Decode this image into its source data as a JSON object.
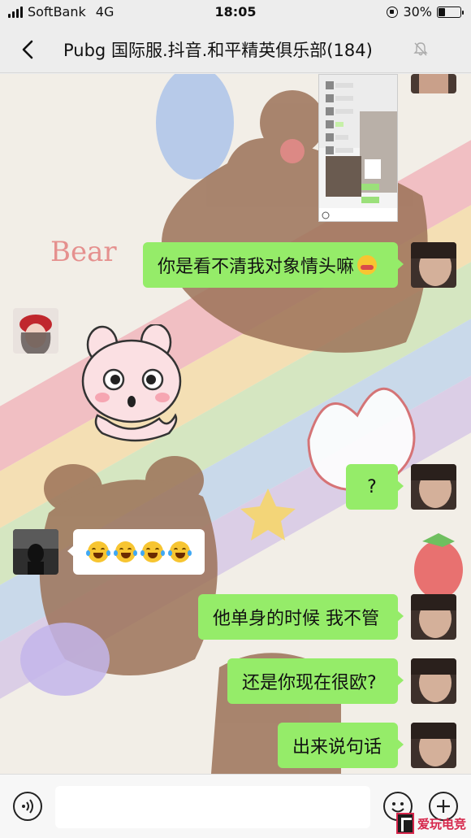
{
  "status_bar": {
    "carrier": "SoftBank",
    "network": "4G",
    "time": "18:05",
    "battery": "30%",
    "battery_level": 0.3
  },
  "header": {
    "title": "Pubg 国际服.抖音.和平精英俱乐部(184)"
  },
  "messages": [
    {
      "side": "sent",
      "kind": "image",
      "content": "screenshot"
    },
    {
      "side": "sent",
      "kind": "text",
      "text": "你是看不清我对象情头嘛",
      "emoji": "flushed-face"
    },
    {
      "side": "received",
      "kind": "sticker",
      "content": "bunny-sticker"
    },
    {
      "side": "sent",
      "kind": "text",
      "text": "?"
    },
    {
      "side": "received",
      "kind": "emoji",
      "emojis": [
        "tears-of-joy",
        "tears-of-joy",
        "tears-of-joy",
        "tears-of-joy"
      ]
    },
    {
      "side": "sent",
      "kind": "text",
      "text": "他单身的时候 我不管"
    },
    {
      "side": "sent",
      "kind": "text",
      "text": "还是你现在很欧?"
    },
    {
      "side": "sent",
      "kind": "text",
      "text": "出来说句话"
    }
  ],
  "input_bar": {
    "placeholder": "",
    "icons": [
      "voice-icon",
      "emoji-icon",
      "plus-icon"
    ]
  },
  "watermark": {
    "text": "爱玩电竞"
  },
  "colors": {
    "sent_bubble": "#95ec69",
    "received_bubble": "#ffffff",
    "header_bg": "#ededed",
    "watermark": "#d6264b"
  }
}
